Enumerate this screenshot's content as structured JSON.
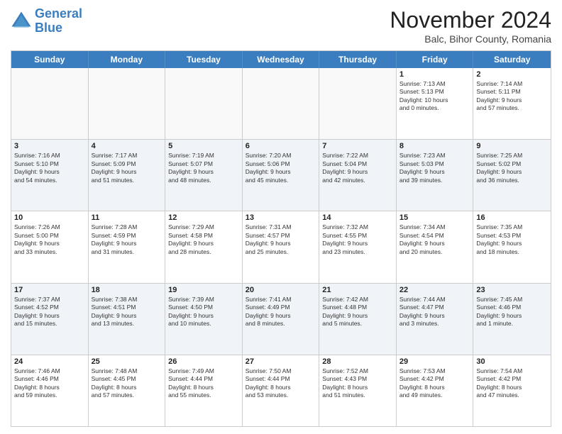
{
  "logo": {
    "line1": "General",
    "line2": "Blue"
  },
  "title": "November 2024",
  "subtitle": "Balc, Bihor County, Romania",
  "days_of_week": [
    "Sunday",
    "Monday",
    "Tuesday",
    "Wednesday",
    "Thursday",
    "Friday",
    "Saturday"
  ],
  "weeks": [
    [
      {
        "day": "",
        "info": "",
        "empty": true
      },
      {
        "day": "",
        "info": "",
        "empty": true
      },
      {
        "day": "",
        "info": "",
        "empty": true
      },
      {
        "day": "",
        "info": "",
        "empty": true
      },
      {
        "day": "",
        "info": "",
        "empty": true
      },
      {
        "day": "1",
        "info": "Sunrise: 7:13 AM\nSunset: 5:13 PM\nDaylight: 10 hours\nand 0 minutes.",
        "empty": false
      },
      {
        "day": "2",
        "info": "Sunrise: 7:14 AM\nSunset: 5:11 PM\nDaylight: 9 hours\nand 57 minutes.",
        "empty": false
      }
    ],
    [
      {
        "day": "3",
        "info": "Sunrise: 7:16 AM\nSunset: 5:10 PM\nDaylight: 9 hours\nand 54 minutes.",
        "empty": false
      },
      {
        "day": "4",
        "info": "Sunrise: 7:17 AM\nSunset: 5:09 PM\nDaylight: 9 hours\nand 51 minutes.",
        "empty": false
      },
      {
        "day": "5",
        "info": "Sunrise: 7:19 AM\nSunset: 5:07 PM\nDaylight: 9 hours\nand 48 minutes.",
        "empty": false
      },
      {
        "day": "6",
        "info": "Sunrise: 7:20 AM\nSunset: 5:06 PM\nDaylight: 9 hours\nand 45 minutes.",
        "empty": false
      },
      {
        "day": "7",
        "info": "Sunrise: 7:22 AM\nSunset: 5:04 PM\nDaylight: 9 hours\nand 42 minutes.",
        "empty": false
      },
      {
        "day": "8",
        "info": "Sunrise: 7:23 AM\nSunset: 5:03 PM\nDaylight: 9 hours\nand 39 minutes.",
        "empty": false
      },
      {
        "day": "9",
        "info": "Sunrise: 7:25 AM\nSunset: 5:02 PM\nDaylight: 9 hours\nand 36 minutes.",
        "empty": false
      }
    ],
    [
      {
        "day": "10",
        "info": "Sunrise: 7:26 AM\nSunset: 5:00 PM\nDaylight: 9 hours\nand 33 minutes.",
        "empty": false
      },
      {
        "day": "11",
        "info": "Sunrise: 7:28 AM\nSunset: 4:59 PM\nDaylight: 9 hours\nand 31 minutes.",
        "empty": false
      },
      {
        "day": "12",
        "info": "Sunrise: 7:29 AM\nSunset: 4:58 PM\nDaylight: 9 hours\nand 28 minutes.",
        "empty": false
      },
      {
        "day": "13",
        "info": "Sunrise: 7:31 AM\nSunset: 4:57 PM\nDaylight: 9 hours\nand 25 minutes.",
        "empty": false
      },
      {
        "day": "14",
        "info": "Sunrise: 7:32 AM\nSunset: 4:55 PM\nDaylight: 9 hours\nand 23 minutes.",
        "empty": false
      },
      {
        "day": "15",
        "info": "Sunrise: 7:34 AM\nSunset: 4:54 PM\nDaylight: 9 hours\nand 20 minutes.",
        "empty": false
      },
      {
        "day": "16",
        "info": "Sunrise: 7:35 AM\nSunset: 4:53 PM\nDaylight: 9 hours\nand 18 minutes.",
        "empty": false
      }
    ],
    [
      {
        "day": "17",
        "info": "Sunrise: 7:37 AM\nSunset: 4:52 PM\nDaylight: 9 hours\nand 15 minutes.",
        "empty": false
      },
      {
        "day": "18",
        "info": "Sunrise: 7:38 AM\nSunset: 4:51 PM\nDaylight: 9 hours\nand 13 minutes.",
        "empty": false
      },
      {
        "day": "19",
        "info": "Sunrise: 7:39 AM\nSunset: 4:50 PM\nDaylight: 9 hours\nand 10 minutes.",
        "empty": false
      },
      {
        "day": "20",
        "info": "Sunrise: 7:41 AM\nSunset: 4:49 PM\nDaylight: 9 hours\nand 8 minutes.",
        "empty": false
      },
      {
        "day": "21",
        "info": "Sunrise: 7:42 AM\nSunset: 4:48 PM\nDaylight: 9 hours\nand 5 minutes.",
        "empty": false
      },
      {
        "day": "22",
        "info": "Sunrise: 7:44 AM\nSunset: 4:47 PM\nDaylight: 9 hours\nand 3 minutes.",
        "empty": false
      },
      {
        "day": "23",
        "info": "Sunrise: 7:45 AM\nSunset: 4:46 PM\nDaylight: 9 hours\nand 1 minute.",
        "empty": false
      }
    ],
    [
      {
        "day": "24",
        "info": "Sunrise: 7:46 AM\nSunset: 4:46 PM\nDaylight: 8 hours\nand 59 minutes.",
        "empty": false
      },
      {
        "day": "25",
        "info": "Sunrise: 7:48 AM\nSunset: 4:45 PM\nDaylight: 8 hours\nand 57 minutes.",
        "empty": false
      },
      {
        "day": "26",
        "info": "Sunrise: 7:49 AM\nSunset: 4:44 PM\nDaylight: 8 hours\nand 55 minutes.",
        "empty": false
      },
      {
        "day": "27",
        "info": "Sunrise: 7:50 AM\nSunset: 4:44 PM\nDaylight: 8 hours\nand 53 minutes.",
        "empty": false
      },
      {
        "day": "28",
        "info": "Sunrise: 7:52 AM\nSunset: 4:43 PM\nDaylight: 8 hours\nand 51 minutes.",
        "empty": false
      },
      {
        "day": "29",
        "info": "Sunrise: 7:53 AM\nSunset: 4:42 PM\nDaylight: 8 hours\nand 49 minutes.",
        "empty": false
      },
      {
        "day": "30",
        "info": "Sunrise: 7:54 AM\nSunset: 4:42 PM\nDaylight: 8 hours\nand 47 minutes.",
        "empty": false
      }
    ]
  ]
}
